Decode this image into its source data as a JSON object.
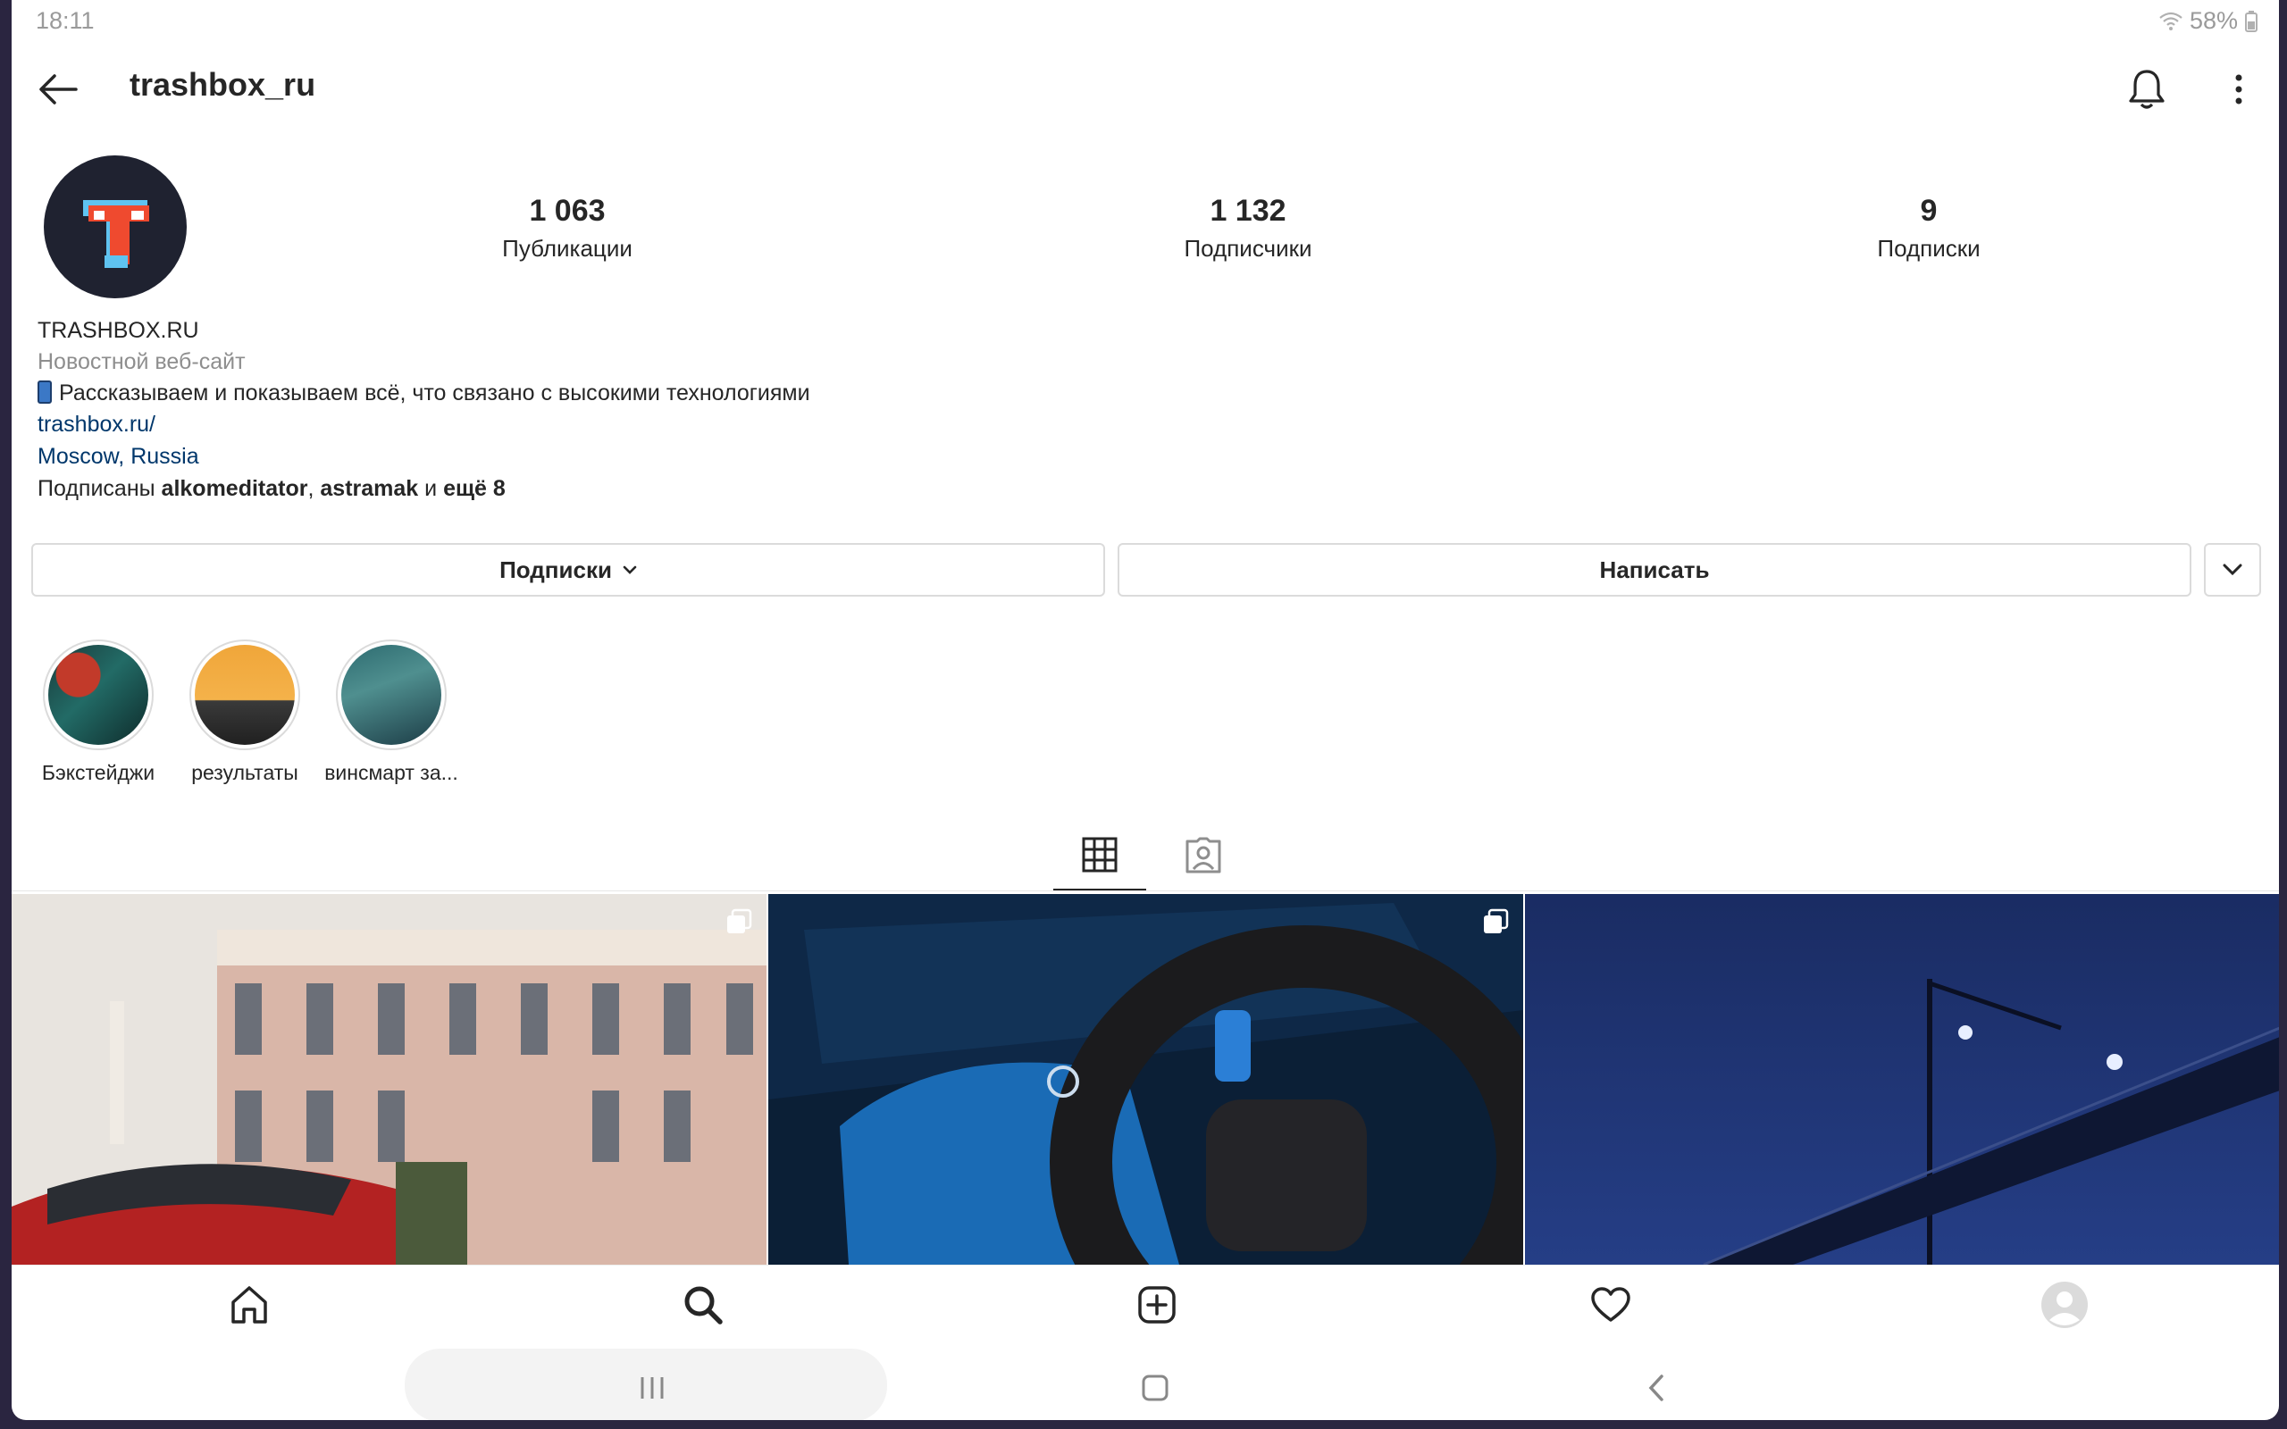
{
  "status_bar": {
    "time": "18:11",
    "battery": "58%"
  },
  "header": {
    "username": "trashbox_ru"
  },
  "stats": [
    {
      "value": "1 063",
      "label": "Публикации"
    },
    {
      "value": "1 132",
      "label": "Подписчики"
    },
    {
      "value": "9",
      "label": "Подписки"
    }
  ],
  "bio": {
    "name": "TRASHBOX.RU",
    "category": "Новостной веб-сайт",
    "text": "Рассказываем и показываем всё, что связано с высокими технологиями",
    "link": "trashbox.ru/",
    "location": "Moscow, Russia",
    "followed_prefix": "Подписаны ",
    "followed_user1": "alkomeditator",
    "followed_sep": ", ",
    "followed_user2": "astramak",
    "followed_and": " и ",
    "followed_more": "ещё 8"
  },
  "actions": {
    "follow_label": "Подписки",
    "message_label": "Написать"
  },
  "highlights": [
    {
      "label": "Бэкстейджи"
    },
    {
      "label": "результаты"
    },
    {
      "label": "винсмарт за..."
    }
  ],
  "colors": {
    "link": "#00376b",
    "secondary_text": "#8e8e8e",
    "border": "#dbdbdb",
    "avatar_logo_red": "#ef4a2f",
    "avatar_logo_blue": "#5fc3f0"
  }
}
